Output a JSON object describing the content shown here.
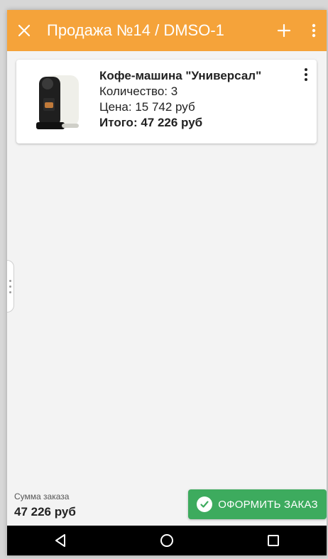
{
  "app_bar": {
    "title": "Продажа №14 / DMSO-1",
    "close_icon": "close-icon",
    "add_icon": "plus-icon",
    "menu_icon": "more-vert-icon",
    "color": "#f5a33a"
  },
  "order_items": [
    {
      "name": "Кофе-машина \"Универсал\"",
      "quantity_text": "Количество: 3",
      "price_text": "Цена: 15 742 руб",
      "total_text": "Итого: 47 226 руб",
      "image_icon": "coffee-machine-image"
    }
  ],
  "footer": {
    "sum_label": "Сумма заказа",
    "sum_value": "47 226 руб",
    "order_button_label": "ОФОРМИТЬ ЗАКАЗ",
    "order_button_color": "#3dab5e"
  },
  "nav_bar": {
    "back_icon": "back-triangle-icon",
    "home_icon": "home-circle-icon",
    "recents_icon": "recents-square-icon"
  }
}
